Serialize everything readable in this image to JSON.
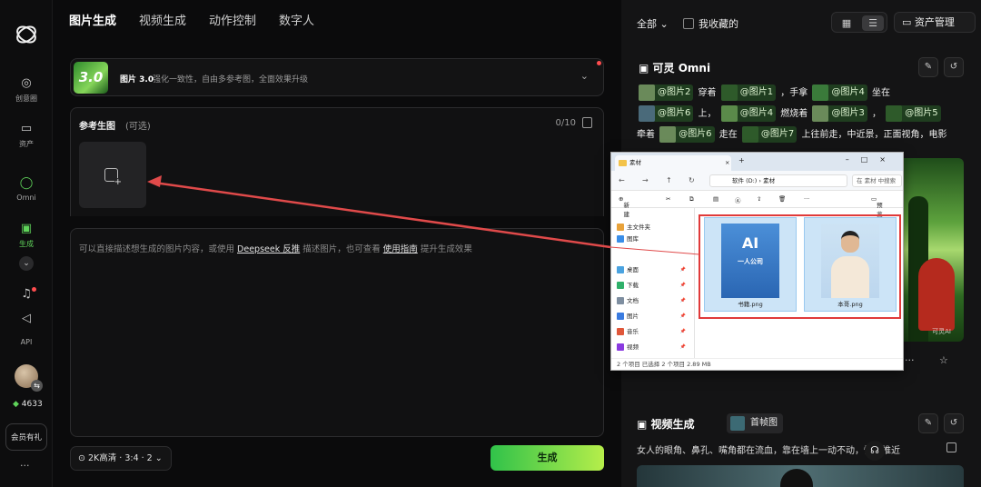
{
  "sidebar": {
    "items": [
      {
        "label": "创意圈",
        "icon": "lightbulb-icon"
      },
      {
        "label": "资产",
        "icon": "folder-icon"
      },
      {
        "label": "Omni",
        "icon": "omni-ring-icon"
      },
      {
        "label": "生成",
        "icon": "generate-icon"
      },
      {
        "label": "API",
        "icon": "api-icon"
      }
    ],
    "credits": "4633",
    "member_label": "会员有礼"
  },
  "tabs": [
    "图片生成",
    "视频生成",
    "动作控制",
    "数字人"
  ],
  "model": {
    "badge": "3.0",
    "name": "图片 3.0",
    "desc": "强化一致性，自由多参考图，全面效果升级"
  },
  "reference": {
    "title": "参考生图",
    "optional": "(可选)",
    "count": "0/10"
  },
  "prompt": {
    "p1": "可以直接描述想生成的图片内容，或使用 ",
    "link1": "Deepseek 反推",
    "p2": " 描述图片，也可查看 ",
    "link2": "使用指南",
    "p3": " 提升生成效果"
  },
  "quality": "2K高清 · 3:4 · 2",
  "generate_label": "生成",
  "right": {
    "filter": "全部",
    "favorites": "我收藏的",
    "assets_manage": "资产管理",
    "card1": {
      "title": "可灵 Omni",
      "line1": [
        {
          "chip": "@图片2"
        },
        {
          "text": "穿着"
        },
        {
          "chip": "@图片1"
        },
        {
          "text": "，手拿"
        },
        {
          "chip": "@图片4"
        },
        {
          "text": "坐在"
        }
      ],
      "line2": [
        {
          "chip": "@图片6"
        },
        {
          "text": "上，"
        },
        {
          "chip": "@图片4"
        },
        {
          "text": "燃烧着"
        },
        {
          "chip": "@图片3"
        },
        {
          "text": "，"
        },
        {
          "chip": "@图片5"
        }
      ],
      "line3": [
        {
          "text": "牵着"
        },
        {
          "chip": "@图片6"
        },
        {
          "text": "走在"
        },
        {
          "chip": "@图片7"
        },
        {
          "text": "上往前走，中近景，正面视角，电影"
        }
      ],
      "watermark": "可灵AI"
    },
    "card2": {
      "title": "视频生成",
      "first_frame": "首帧图",
      "text": "女人的眼角、鼻孔、嘴角都在流血，靠在墙上一动不动，慢慢推近"
    }
  },
  "explorer": {
    "tab_title": "素材",
    "path": [
      "软件 (D:)",
      "素材"
    ],
    "search": "在 素材 中搜索",
    "new_label": "新建",
    "preview_label": "预览",
    "sidebar": [
      "主文件夹",
      "图库",
      "桌面",
      "下载",
      "文档",
      "图片",
      "音乐",
      "视频"
    ],
    "files": [
      {
        "name": "书籍.png",
        "book_title": "AI\n一人公司"
      },
      {
        "name": "本哥.png"
      }
    ],
    "status": "2 个项目    已选择 2 个项目  2.89 MB"
  },
  "colors": {
    "accent": "#5fd35a",
    "highlight": "#e03a3a",
    "arrow": "#e04a4a"
  }
}
